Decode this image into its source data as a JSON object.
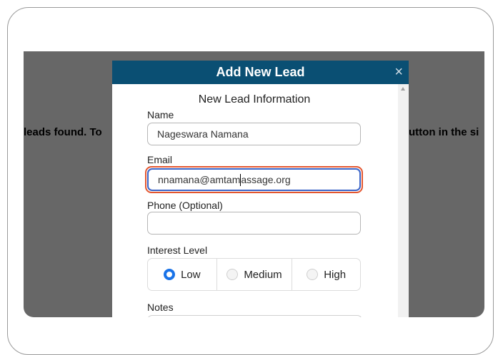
{
  "background": {
    "left_text": "leads found. To",
    "right_text": "utton in the si"
  },
  "modal": {
    "title": "Add New Lead",
    "close_label": "×",
    "section_title": "New Lead Information",
    "name": {
      "label": "Name",
      "value": "Nageswara Namana"
    },
    "email": {
      "label": "Email",
      "value_before_caret": "nnamana@amtam",
      "value_after_caret": "assage.org"
    },
    "phone": {
      "label": "Phone (Optional)",
      "value": ""
    },
    "interest": {
      "label": "Interest Level",
      "options": [
        "Low",
        "Medium",
        "High"
      ],
      "selected": "Low"
    },
    "notes": {
      "label": "Notes"
    }
  },
  "colors": {
    "header": "#0a4f73",
    "radio_selected": "#1a73e8",
    "focus_highlight": "#e4562f",
    "overlay": "#676767"
  }
}
